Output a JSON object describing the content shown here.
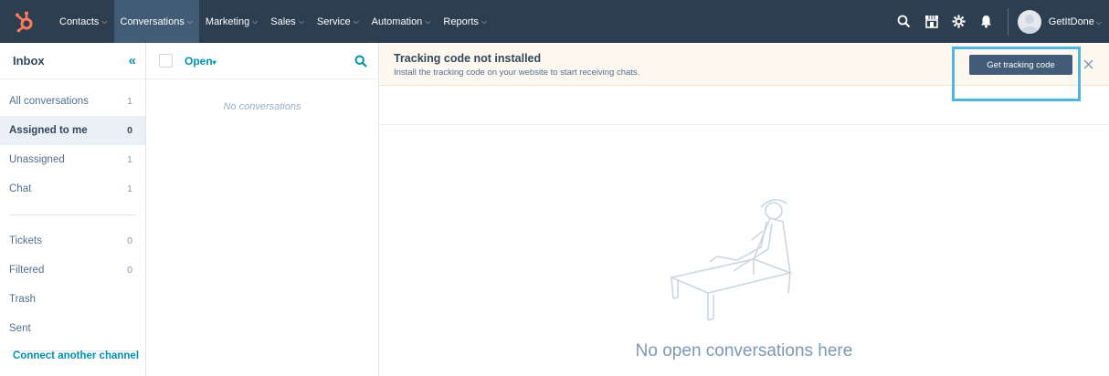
{
  "topnav": {
    "items": [
      {
        "label": "Contacts"
      },
      {
        "label": "Conversations"
      },
      {
        "label": "Marketing"
      },
      {
        "label": "Sales"
      },
      {
        "label": "Service"
      },
      {
        "label": "Automation"
      },
      {
        "label": "Reports"
      }
    ],
    "account_name": "GetItDone",
    "icons": [
      "search-icon",
      "marketplace-icon",
      "settings-icon",
      "notifications-icon"
    ],
    "colors": {
      "bar": "#2d3e50",
      "active": "#425b76",
      "logo": "#ff7a59"
    }
  },
  "sidebar": {
    "title": "Inbox",
    "items": [
      {
        "label": "All conversations",
        "count": "1"
      },
      {
        "label": "Assigned to me",
        "count": "0"
      },
      {
        "label": "Unassigned",
        "count": "1"
      },
      {
        "label": "Chat",
        "count": "1"
      }
    ],
    "items2": [
      {
        "label": "Tickets",
        "count": "0"
      },
      {
        "label": "Filtered",
        "count": "0"
      },
      {
        "label": "Trash",
        "count": ""
      },
      {
        "label": "Sent",
        "count": ""
      }
    ],
    "connect_link": "Connect another channel"
  },
  "list": {
    "filter_label": "Open",
    "empty_text": "No conversations"
  },
  "banner": {
    "title": "Tracking code not installed",
    "text": "Install the tracking code on your website to start receiving chats.",
    "button_label": "Get tracking code",
    "highlight_color": "#4fb6e1"
  },
  "main": {
    "empty_text": "No open conversations here"
  }
}
